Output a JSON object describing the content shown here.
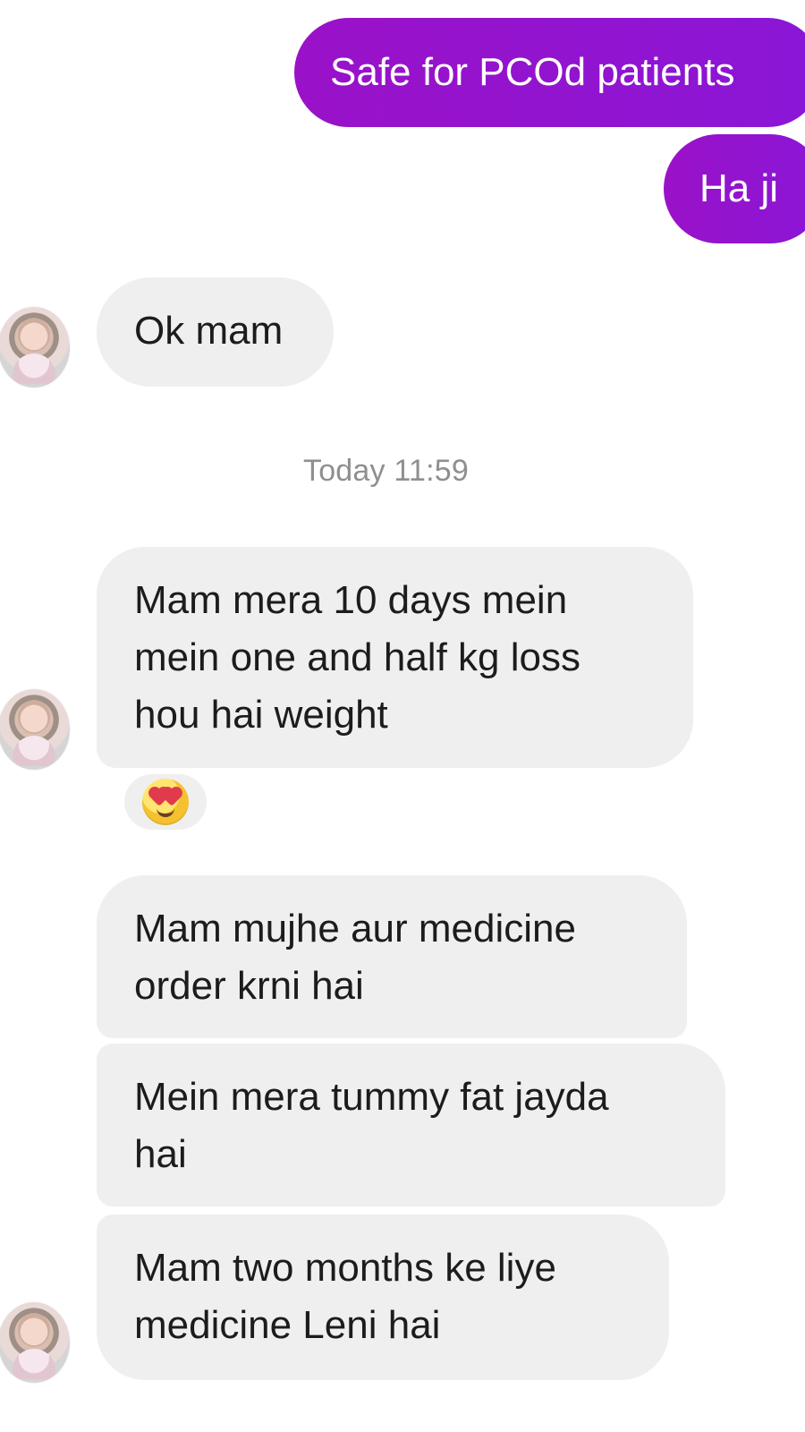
{
  "conversation": {
    "messages": {
      "out1": "Safe for PCOd patients",
      "out2": "Ha ji",
      "in1": "Ok mam",
      "in2": "Mam mera 10 days mein\nmein one and half kg loss\nhou hai weight",
      "in3": "Mam mujhe aur medicine\norder krni hai",
      "in4": "Mein mera tummy fat jayda\nhai",
      "in5": "Mam two months ke liye\nmedicine Leni hai"
    },
    "timestamp": "Today 11:59",
    "reaction_icon": "heart-eyes-emoji-icon",
    "avatar_icon": "baby-avatar-icon",
    "colors": {
      "outgoing_start": "#9a12c8",
      "outgoing_end": "#8a16d6",
      "incoming_bubble": "#efefef",
      "timestamp_text": "#8f8f8f"
    }
  }
}
